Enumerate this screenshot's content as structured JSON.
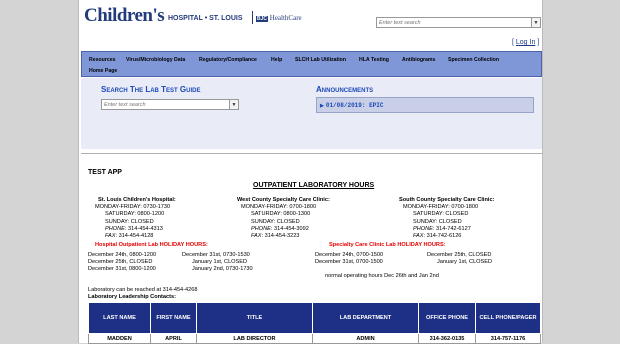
{
  "header": {
    "logo_word": "Children's",
    "logo_hospital": "HOSPITAL • ST. LOUIS",
    "logo_bjc": "BJC",
    "logo_healthcare": "HealthCare",
    "search_placeholder": "Enter text search",
    "login_label": "Log In"
  },
  "nav": {
    "items": [
      "Resources",
      "Virus/Microbiology Data",
      "Regulatory/Compliance",
      "Help",
      "SLCH Lab Utilization",
      "HLA Testing",
      "Antibiograms",
      "Specimen Collection",
      "Home Page"
    ]
  },
  "guide": {
    "title": "Search The Lab Test Guide",
    "search_placeholder": "Enter text search"
  },
  "announcements": {
    "title": "Announcements",
    "items": [
      "01/08/2019: EPIC"
    ]
  },
  "content": {
    "app_title": "TEST APP",
    "hours_title": "OUTPATIENT LABORATORY HOURS",
    "locations": [
      {
        "name": "St. Louis Children's Hospital:",
        "lines": [
          "MONDAY-FRIDAY: 0730-1730",
          "SATURDAY: 0800-1200",
          "SUNDAY: CLOSED"
        ],
        "phone_label": "PHONE",
        "phone": ": 314-454-4313",
        "fax_label": "FAX",
        "fax": ": 314-454-4128"
      },
      {
        "name": "West County Specialty Care Clinic:",
        "lines": [
          "MONDAY-FRIDAY: 0700-1800",
          "SATURDAY: 0800-1300",
          "SUNDAY: CLOSED"
        ],
        "phone_label": "PHONE",
        "phone": ": 314-454-3092",
        "fax_label": "FAX",
        "fax": ": 314-454-3223"
      },
      {
        "name": "South County Specialty Care Clinic:",
        "lines": [
          "MONDAY-FRIDAY: 0700-1800",
          "SATURDAY: CLOSED",
          "SUNDAY: CLOSED"
        ],
        "phone_label": "PHONE",
        "phone": ": 314-742-6127",
        "fax_label": "FAX",
        "fax": ": 314-742-6126"
      }
    ],
    "hospital_holiday_title": "Hospital Outpatient Lab HOLIDAY HOURS:",
    "hospital_holiday_left": [
      "December 24th, 0800-1200",
      "December 25th, CLOSED",
      "December 31st, 0800-1200"
    ],
    "hospital_holiday_right": [
      "December 31st, 0730-1530",
      "January 1st, CLOSED",
      "January 2nd, 0730-1730"
    ],
    "specialty_holiday_title": "Specialty Care Clinic Lab HOLIDAY HOURS:",
    "specialty_holiday_left": [
      "December 24th, 0700-1500",
      "December 31st, 0700-1500"
    ],
    "specialty_holiday_right": [
      "December 25th, CLOSED",
      "January 1st, CLOSED"
    ],
    "specialty_holiday_note": [
      "normal operating hours Dec 26th and Jan 2nd"
    ],
    "lab_reach": "Laboratory can be reached at 314-454-4268",
    "leadership_title": "Laboratory Leadership Contacts:"
  },
  "leadership_table": {
    "headers": [
      "LAST NAME",
      "FIRST NAME",
      "TITLE",
      "LAB DEPARTMENT",
      "OFFICE PHONE",
      "CELL PHONE/PAGER"
    ],
    "rows": [
      [
        "MADDEN",
        "APRIL",
        "LAB DIRECTOR",
        "ADMIN",
        "314-362-0135",
        "314-757-1176"
      ]
    ]
  }
}
